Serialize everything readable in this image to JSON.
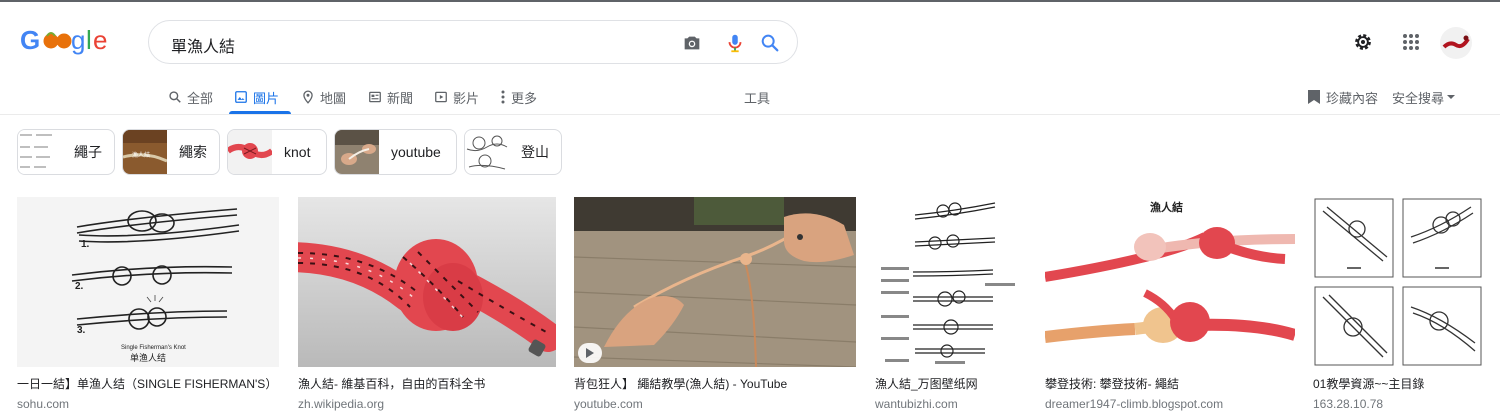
{
  "header": {
    "logo_text": "Google",
    "search_query": "單漁人結"
  },
  "tabs": [
    {
      "label": "全部",
      "icon": "search-icon"
    },
    {
      "label": "圖片",
      "icon": "image-icon",
      "active": true
    },
    {
      "label": "地圖",
      "icon": "map-pin-icon"
    },
    {
      "label": "新聞",
      "icon": "news-icon"
    },
    {
      "label": "影片",
      "icon": "video-icon"
    },
    {
      "label": "更多",
      "icon": "more-vert-icon"
    }
  ],
  "tools_label": "工具",
  "collections_label": "珍藏內容",
  "safe_search_label": "安全搜尋",
  "chips": [
    {
      "label": "繩子"
    },
    {
      "label": "繩索"
    },
    {
      "label": "knot"
    },
    {
      "label": "youtube"
    },
    {
      "label": "登山"
    }
  ],
  "results": [
    {
      "title": "一日一結】单渔人结（SINGLE FISHERMAN'S）",
      "site": "sohu.com"
    },
    {
      "title": "漁人結- 維基百科，自由的百科全书",
      "site": "zh.wikipedia.org"
    },
    {
      "title": "背包狂人】 繩結教學(漁人結) - YouTube",
      "site": "youtube.com"
    },
    {
      "title": "漁人結_万图壁纸网",
      "site": "wantubizhi.com"
    },
    {
      "title": "攀登技術: 攀登技術- 繩結",
      "site": "dreamer1947-climb.blogspot.com"
    },
    {
      "title": "01教學資源~~主目錄",
      "site": "163.28.10.78"
    }
  ],
  "image_text": {
    "sohu_step1": "1.",
    "sohu_step2": "2.",
    "sohu_step3": "3.",
    "sohu_caption_en": "Single Fisherman's Knot",
    "sohu_caption_zh": "单渔人结",
    "blogspot_title": "漁人結",
    "chip_rope2_text": "漁人結"
  },
  "colors": {
    "accent_blue": "#1a73e8",
    "rope_red": "#e2474f",
    "tab_gray": "#5f6368"
  }
}
